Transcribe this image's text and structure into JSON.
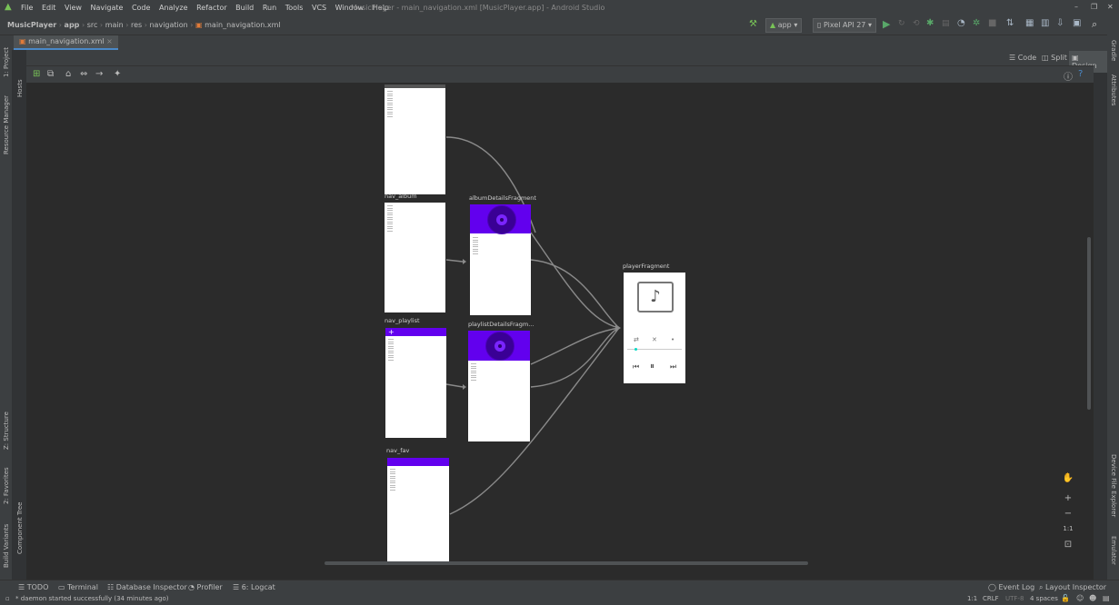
{
  "menu": [
    "File",
    "Edit",
    "View",
    "Navigate",
    "Code",
    "Analyze",
    "Refactor",
    "Build",
    "Run",
    "Tools",
    "VCS",
    "Window",
    "Help"
  ],
  "window_title": "MusicPlayer - main_navigation.xml [MusicPlayer.app] - Android Studio",
  "window_controls": [
    "–",
    "❐",
    "✕"
  ],
  "breadcrumb": [
    "MusicPlayer",
    "app",
    "src",
    "main",
    "res",
    "navigation",
    "main_navigation.xml"
  ],
  "run_config": "app",
  "device": "Pixel API 27",
  "file_tab": "main_navigation.xml",
  "view_modes": [
    "Code",
    "Split",
    "Design"
  ],
  "left_tools": [
    "1: Project",
    "Resource Manager",
    "Z: Structure",
    "2: Favorites",
    "Build Variants"
  ],
  "left_inner_tools": [
    "Hosts",
    "Component Tree"
  ],
  "right_tools": [
    "Gradle",
    "Attributes",
    "Device File Explorer",
    "Emulator"
  ],
  "destinations": {
    "nav_album": "nav_album",
    "nav_playlist": "nav_playlist",
    "nav_fav": "nav_fav",
    "album_details": "albumDetailsFragment",
    "playlist_details": "playlistDetailsFragm...",
    "player": "playerFragment"
  },
  "zoom_controls": [
    "+",
    "−",
    "1:1"
  ],
  "bottom_tools": [
    "TODO",
    "Terminal",
    "Database Inspector",
    "Profiler",
    "6: Logcat"
  ],
  "bottom_right_tools": [
    "Event Log",
    "Layout Inspector"
  ],
  "status_message": "* daemon started successfully (34 minutes ago)",
  "status_right": [
    "1:1",
    "CRLF",
    "UTF-8",
    "4 spaces"
  ],
  "colors": {
    "accent": "#6200ee",
    "bg": "#2b2b2b",
    "panel": "#3c3f41",
    "edge": "#8a8a8a"
  }
}
